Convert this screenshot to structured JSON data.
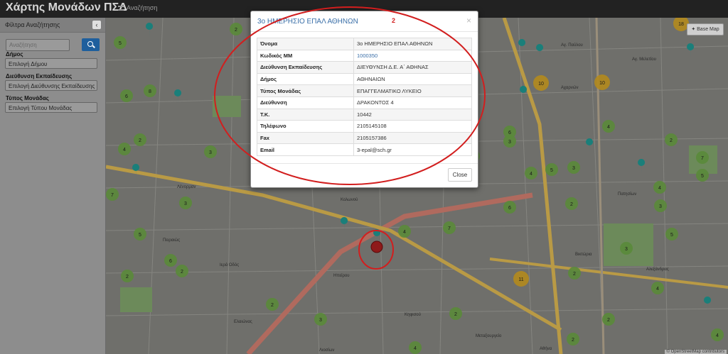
{
  "navbar": {
    "title": "Χάρτης Μονάδων ΠΣΔ",
    "search_link": "Αναζήτηση"
  },
  "sidebar": {
    "header": "Φίλτρα Αναζήτησης",
    "collapse_glyph": "‹",
    "search_placeholder": "Αναζήτηση",
    "filters": [
      {
        "label": "Δήμος",
        "value": "Επιλογή Δήμου"
      },
      {
        "label": "Διεύθυνση Εκπαίδευσης",
        "value": "Επιλογή Διεύθυνσης Εκπαίδευσης"
      },
      {
        "label": "Τύπος Μονάδας",
        "value": "Επιλογή Τύπου Μονάδας"
      }
    ]
  },
  "map": {
    "base_map_label": "Base Map",
    "attribution": "© OpenStreetMap contributors",
    "street_labels": [
      "Κολωνού",
      "Μεταξουργείο",
      "Ελαιώνας",
      "Βικτώρια",
      "Αθήνα",
      "Αγ. Παύλου",
      "Αχαρνών",
      "Λένορμαν",
      "Κηφισού",
      "Ιερά Οδός",
      "Πειραιώς",
      "Αλεξάνδρας",
      "Πατησίων",
      "Ηπείρου",
      "Αγ. Μελετίου",
      "Λιοσίων"
    ],
    "marker_colors": {
      "green": "#5a8a3a",
      "yellow": "#b38a1d",
      "teal": "#1a7f7a",
      "magenta": "#b02a8a",
      "highlight": "#8e1a1a"
    },
    "clusters": [
      {
        "count": "2",
        "color": "green"
      },
      {
        "count": "5",
        "color": "green"
      },
      {
        "count": "6",
        "color": "green"
      },
      {
        "count": "8",
        "color": "green"
      },
      {
        "count": "2",
        "color": "green"
      },
      {
        "count": "4",
        "color": "green"
      },
      {
        "count": "3",
        "color": "green"
      },
      {
        "count": "7",
        "color": "green"
      },
      {
        "count": "3",
        "color": "green"
      },
      {
        "count": "5",
        "color": "green"
      },
      {
        "count": "6",
        "color": "green"
      },
      {
        "count": "2",
        "color": "green"
      },
      {
        "count": "2",
        "color": "green"
      },
      {
        "count": "4",
        "color": "green"
      },
      {
        "count": "7",
        "color": "green"
      },
      {
        "count": "2",
        "color": "green"
      },
      {
        "count": "3",
        "color": "green"
      },
      {
        "count": "4",
        "color": "green"
      },
      {
        "count": "2",
        "color": "green"
      },
      {
        "count": "6",
        "color": "green"
      },
      {
        "count": "2",
        "color": "green"
      },
      {
        "count": "3",
        "color": "green"
      },
      {
        "count": "4",
        "color": "green"
      },
      {
        "count": "3",
        "color": "green"
      },
      {
        "count": "2",
        "color": "green"
      },
      {
        "count": "5",
        "color": "green"
      },
      {
        "count": "6",
        "color": "green"
      },
      {
        "count": "4",
        "color": "green"
      },
      {
        "count": "2",
        "color": "green"
      },
      {
        "count": "7",
        "color": "green"
      },
      {
        "count": "4",
        "color": "green"
      },
      {
        "count": "3",
        "color": "green"
      },
      {
        "count": "5",
        "color": "green"
      },
      {
        "count": "2",
        "color": "green"
      },
      {
        "count": "3",
        "color": "green"
      },
      {
        "count": "4",
        "color": "green"
      },
      {
        "count": "2",
        "color": "green"
      },
      {
        "count": "2",
        "color": "green"
      },
      {
        "count": "4",
        "color": "green"
      },
      {
        "count": "5",
        "color": "green"
      },
      {
        "count": "10",
        "color": "yellow"
      },
      {
        "count": "10",
        "color": "yellow"
      },
      {
        "count": "11",
        "color": "yellow"
      },
      {
        "count": "18",
        "color": "yellow"
      }
    ]
  },
  "modal": {
    "title": "3ο ΗΜΕΡΗΣΙΟ ΕΠΑΛ ΑΘΗΝΩΝ",
    "close_x": "×",
    "rows": [
      {
        "key": "Όνομα",
        "value": "3ο ΗΜΕΡΗΣΙΟ ΕΠΑΛ ΑΘΗΝΩΝ"
      },
      {
        "key": "Κωδικός ΜΜ",
        "value": "1000350"
      },
      {
        "key": "Διεύθυνση Εκπαίδευσης",
        "value": "ΔΙΕΥΘΥΝΣΗ Δ.Ε. Α΄ ΑΘΗΝΑΣ"
      },
      {
        "key": "Δήμος",
        "value": "ΑΘΗΝΑΙΩΝ"
      },
      {
        "key": "Τύπος Μονάδας",
        "value": "ΕΠΑΓΓΕΛΜΑΤΙΚΟ ΛΥΚΕΙΟ"
      },
      {
        "key": "Διεύθυνση",
        "value": "ΔΡΑΚΟΝΤΟΣ 4"
      },
      {
        "key": "Τ.Κ.",
        "value": "10442"
      },
      {
        "key": "Τηλέφωνο",
        "value": "2105145108"
      },
      {
        "key": "Fax",
        "value": "2105157386"
      },
      {
        "key": "Email",
        "value": "3-epal@sch.gr"
      }
    ],
    "close_button": "Close"
  },
  "annotation": {
    "label": "2",
    "color": "#d21e1e"
  }
}
